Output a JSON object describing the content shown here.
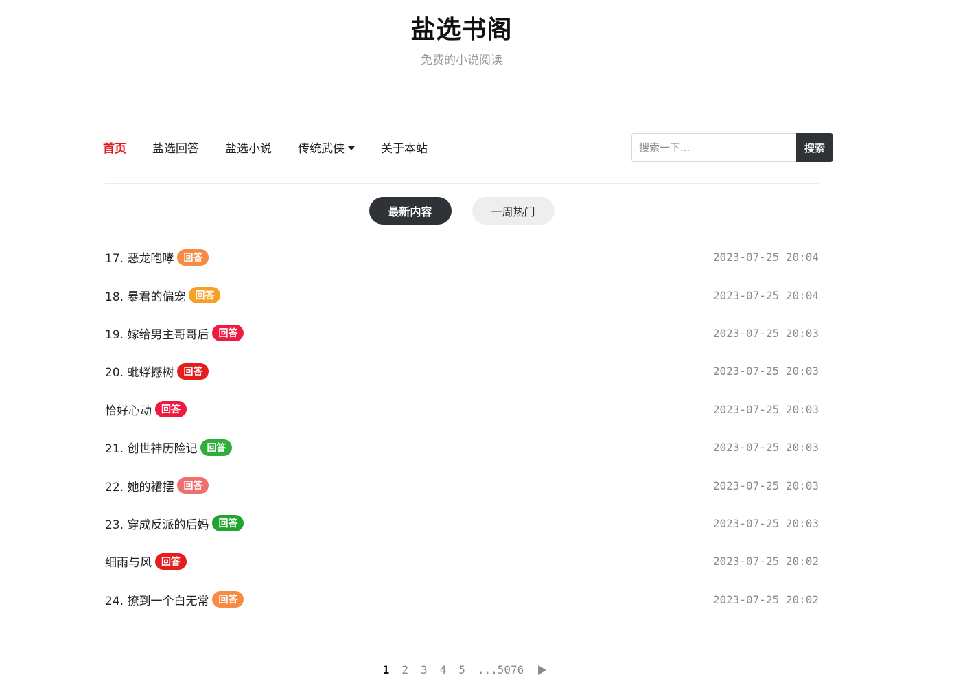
{
  "site": {
    "title": "盐选书阁",
    "subtitle": "免费的小说阅读"
  },
  "nav": {
    "items": [
      {
        "label": "首页",
        "active": true
      },
      {
        "label": "盐选回答",
        "active": false
      },
      {
        "label": "盐选小说",
        "active": false
      },
      {
        "label": "传统武侠",
        "active": false,
        "dropdown": true
      },
      {
        "label": "关于本站",
        "active": false
      }
    ],
    "accent_color": "#e8141b"
  },
  "search": {
    "placeholder": "搜索一下...",
    "button_label": "搜索"
  },
  "tabs": [
    {
      "label": "最新内容",
      "active": true
    },
    {
      "label": "一周热门",
      "active": false
    }
  ],
  "items": [
    {
      "title": "17. 恶龙咆哮",
      "badge": "回答",
      "badge_color": "#f58b45",
      "time": "2023-07-25 20:04"
    },
    {
      "title": "18. 暴君的偏宠",
      "badge": "回答",
      "badge_color": "#f5a027",
      "time": "2023-07-25 20:04"
    },
    {
      "title": "19. 嫁给男主哥哥后",
      "badge": "回答",
      "badge_color": "#ee1a41",
      "time": "2023-07-25 20:03"
    },
    {
      "title": "20. 蚍蜉撼树",
      "badge": "回答",
      "badge_color": "#e41d1d",
      "time": "2023-07-25 20:03"
    },
    {
      "title": "恰好心动",
      "badge": "回答",
      "badge_color": "#ee1a41",
      "time": "2023-07-25 20:03"
    },
    {
      "title": "21. 创世神历险记",
      "badge": "回答",
      "badge_color": "#2fae3a",
      "time": "2023-07-25 20:03"
    },
    {
      "title": "22. 她的裙摆",
      "badge": "回答",
      "badge_color": "#f07070",
      "time": "2023-07-25 20:03"
    },
    {
      "title": "23. 穿成反派的后妈",
      "badge": "回答",
      "badge_color": "#22a52e",
      "time": "2023-07-25 20:03"
    },
    {
      "title": "细雨与风",
      "badge": "回答",
      "badge_color": "#e41d1d",
      "time": "2023-07-25 20:02"
    },
    {
      "title": "24. 撩到一个白无常",
      "badge": "回答",
      "badge_color": "#f58b45",
      "time": "2023-07-25 20:02"
    }
  ],
  "pagination": {
    "pages": [
      "1",
      "2",
      "3",
      "4",
      "5",
      "...5076"
    ],
    "current": "1"
  },
  "icons": {
    "dropdown": "caret-down-icon",
    "next": "play-arrow-icon"
  }
}
